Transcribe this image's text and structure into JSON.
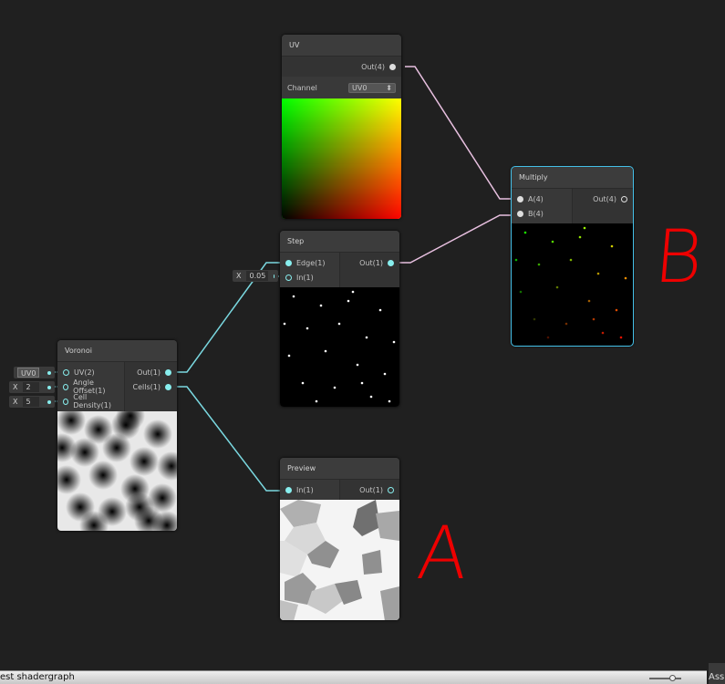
{
  "nodes": {
    "uv": {
      "title": "UV",
      "out": "Out(4)",
      "channel_label": "Channel",
      "channel_value": "UV0"
    },
    "multiply": {
      "title": "Multiply",
      "in_a": "A(4)",
      "in_b": "B(4)",
      "out": "Out(4)"
    },
    "step": {
      "title": "Step",
      "in_edge": "Edge(1)",
      "in_in": "In(1)",
      "out": "Out(1)",
      "in_value_axis": "X",
      "in_value": "0.05"
    },
    "voronoi": {
      "title": "Voronoi",
      "in_uv": "UV(2)",
      "in_angle": "Angle Offset(1)",
      "in_density": "Cell Density(1)",
      "out": "Out(1)",
      "cells": "Cells(1)",
      "uv_value": "UV0",
      "angle_axis": "X",
      "angle_value": "2",
      "density_axis": "X",
      "density_value": "5"
    },
    "preview": {
      "title": "Preview",
      "in": "In(1)",
      "out": "Out(1)"
    }
  },
  "annotations": {
    "a": "A",
    "b": "B"
  },
  "bottom_bar": {
    "file": "est shadergraph",
    "side_tab": "Ass"
  },
  "colors": {
    "wire_vec4": "#e8c0e0",
    "wire_vec1": "#7ad8e0",
    "selection": "#44c0e8"
  }
}
